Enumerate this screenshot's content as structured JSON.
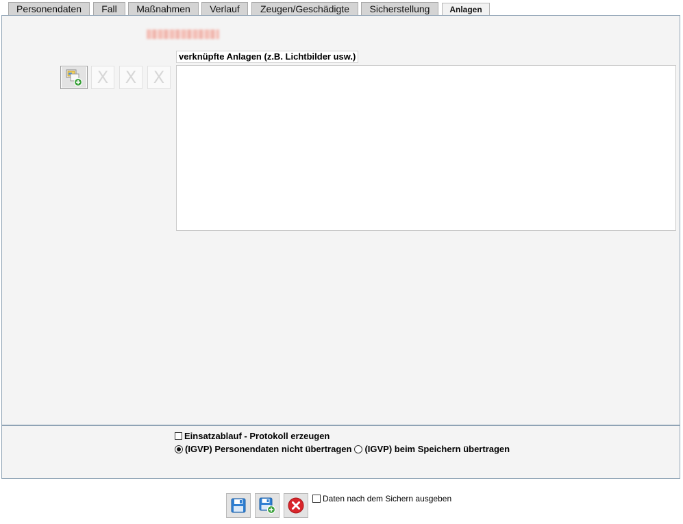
{
  "tabs": [
    {
      "label": "Personendaten"
    },
    {
      "label": "Fall"
    },
    {
      "label": "Maßnahmen"
    },
    {
      "label": "Verlauf"
    },
    {
      "label": "Zeugen/Geschädigte"
    },
    {
      "label": "Sicherstellung"
    },
    {
      "label": "Anlagen",
      "active": true
    }
  ],
  "attachments": {
    "list_label": "verknüpfte Anlagen (z.B. Lichtbilder usw.)",
    "add_icon": "add-attachment-icon",
    "remove_icons": [
      "remove-icon",
      "remove-icon",
      "remove-icon"
    ],
    "remove_glyph": "X",
    "items": []
  },
  "options": {
    "protocol_checkbox_label": "Einsatzablauf - Protokoll erzeugen",
    "protocol_checked": false,
    "igvp_options": [
      {
        "label": "(IGVP) Personendaten nicht übertragen",
        "selected": true
      },
      {
        "label": "(IGVP) beim Speichern übertragen",
        "selected": false
      }
    ]
  },
  "footer": {
    "save_icon": "save-icon",
    "save_new_icon": "save-add-icon",
    "cancel_icon": "cancel-icon",
    "output_after_save_label": "Daten nach dem Sichern ausgeben",
    "output_after_save_checked": false
  },
  "colors": {
    "panel_border": "#8fa3b5",
    "panel_bg": "#f4f4f4",
    "cancel_red": "#d9262b",
    "add_green": "#3aa03a",
    "save_blue": "#2f7fd2"
  }
}
